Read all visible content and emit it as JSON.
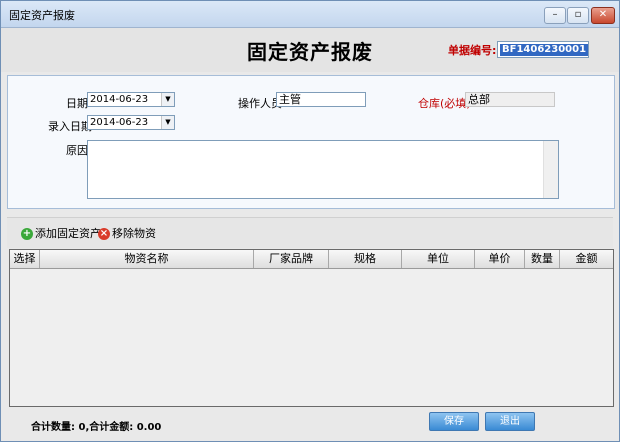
{
  "window": {
    "title": "固定资产报废"
  },
  "header": {
    "title": "固定资产报废",
    "bill_label": "单据编号:",
    "bill_no": "BF1406230001"
  },
  "form": {
    "date_label": "日期",
    "date_value": "2014-06-23",
    "entry_date_label": "录入日期",
    "entry_date_value": "2014-06-23",
    "operator_label": "操作人员",
    "operator_value": "主管",
    "warehouse_label": "仓库(必填)",
    "warehouse_value": "总部",
    "reason_label": "原因"
  },
  "toolbar": {
    "add_label": "添加固定资产",
    "remove_label": "移除物资"
  },
  "grid": {
    "columns": [
      "选择",
      "物资名称",
      "厂家品牌",
      "规格",
      "单位",
      "单价",
      "数量",
      "金额"
    ]
  },
  "footer": {
    "summary": "合计数量: 0,合计金额: 0.00",
    "save_label": "保存",
    "exit_label": "退出"
  },
  "colors": {
    "required_label": "#c00000",
    "accent": "#3a8ad4"
  }
}
